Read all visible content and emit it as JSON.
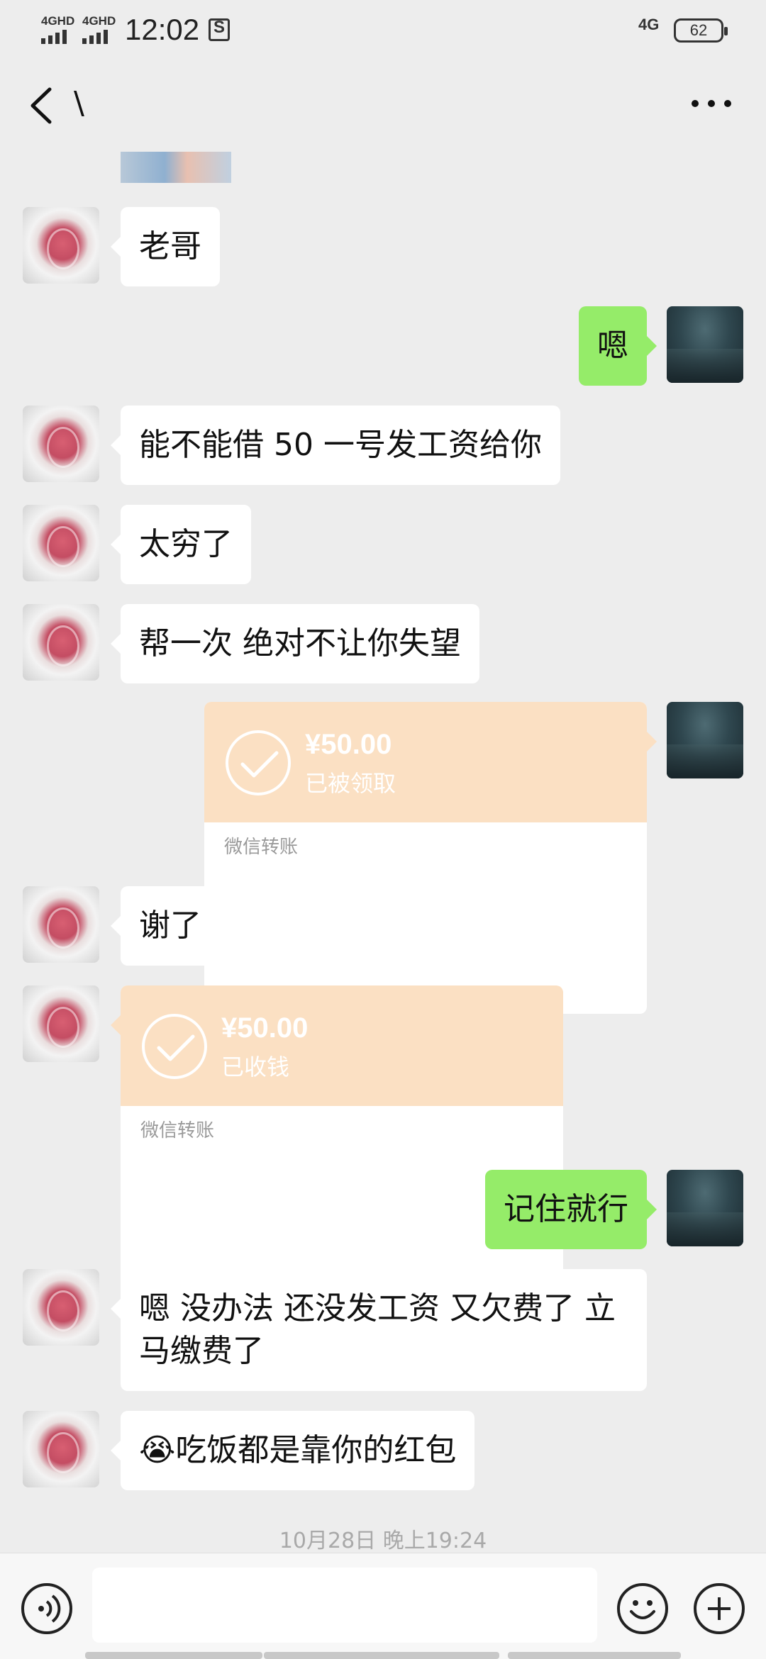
{
  "status_bar": {
    "signal1": "4GHD",
    "signal2": "4GHD",
    "time": "12:02",
    "network": "4G",
    "battery": "62"
  },
  "header": {
    "title": "\\",
    "back_icon": "chevron-left-icon",
    "more_icon": "more-dots-icon"
  },
  "messages": [
    {
      "side": "left",
      "type": "text",
      "text": "老哥"
    },
    {
      "side": "right",
      "type": "text",
      "text": "嗯"
    },
    {
      "side": "left",
      "type": "text",
      "text": "能不能借 50 一号发工资给你"
    },
    {
      "side": "left",
      "type": "text",
      "text": "太穷了"
    },
    {
      "side": "left",
      "type": "text",
      "text": "帮一次  绝对不让你失望"
    },
    {
      "side": "right",
      "type": "transfer",
      "amount": "¥50.00",
      "status": "已被领取",
      "label": "微信转账"
    },
    {
      "side": "left",
      "type": "text",
      "text": "谢了"
    },
    {
      "side": "left",
      "type": "transfer",
      "amount": "¥50.00",
      "status": "已收钱",
      "label": "微信转账"
    },
    {
      "side": "right",
      "type": "text",
      "text": "记住就行"
    },
    {
      "side": "left",
      "type": "text",
      "text": "嗯 没办法 还没发工资 又欠费了 立马缴费了"
    },
    {
      "side": "left",
      "type": "text",
      "text": "吃饭都是靠你的红包",
      "emoji": "😭"
    }
  ],
  "timestamp": "10月28日 晚上19:24",
  "input_bar": {
    "voice_icon": "voice-icon",
    "emoji_icon": "emoji-icon",
    "plus_icon": "plus-icon"
  },
  "colors": {
    "background": "#ededed",
    "bubble_left": "#ffffff",
    "bubble_right": "#95ec69",
    "transfer": "#fbe0c3"
  }
}
